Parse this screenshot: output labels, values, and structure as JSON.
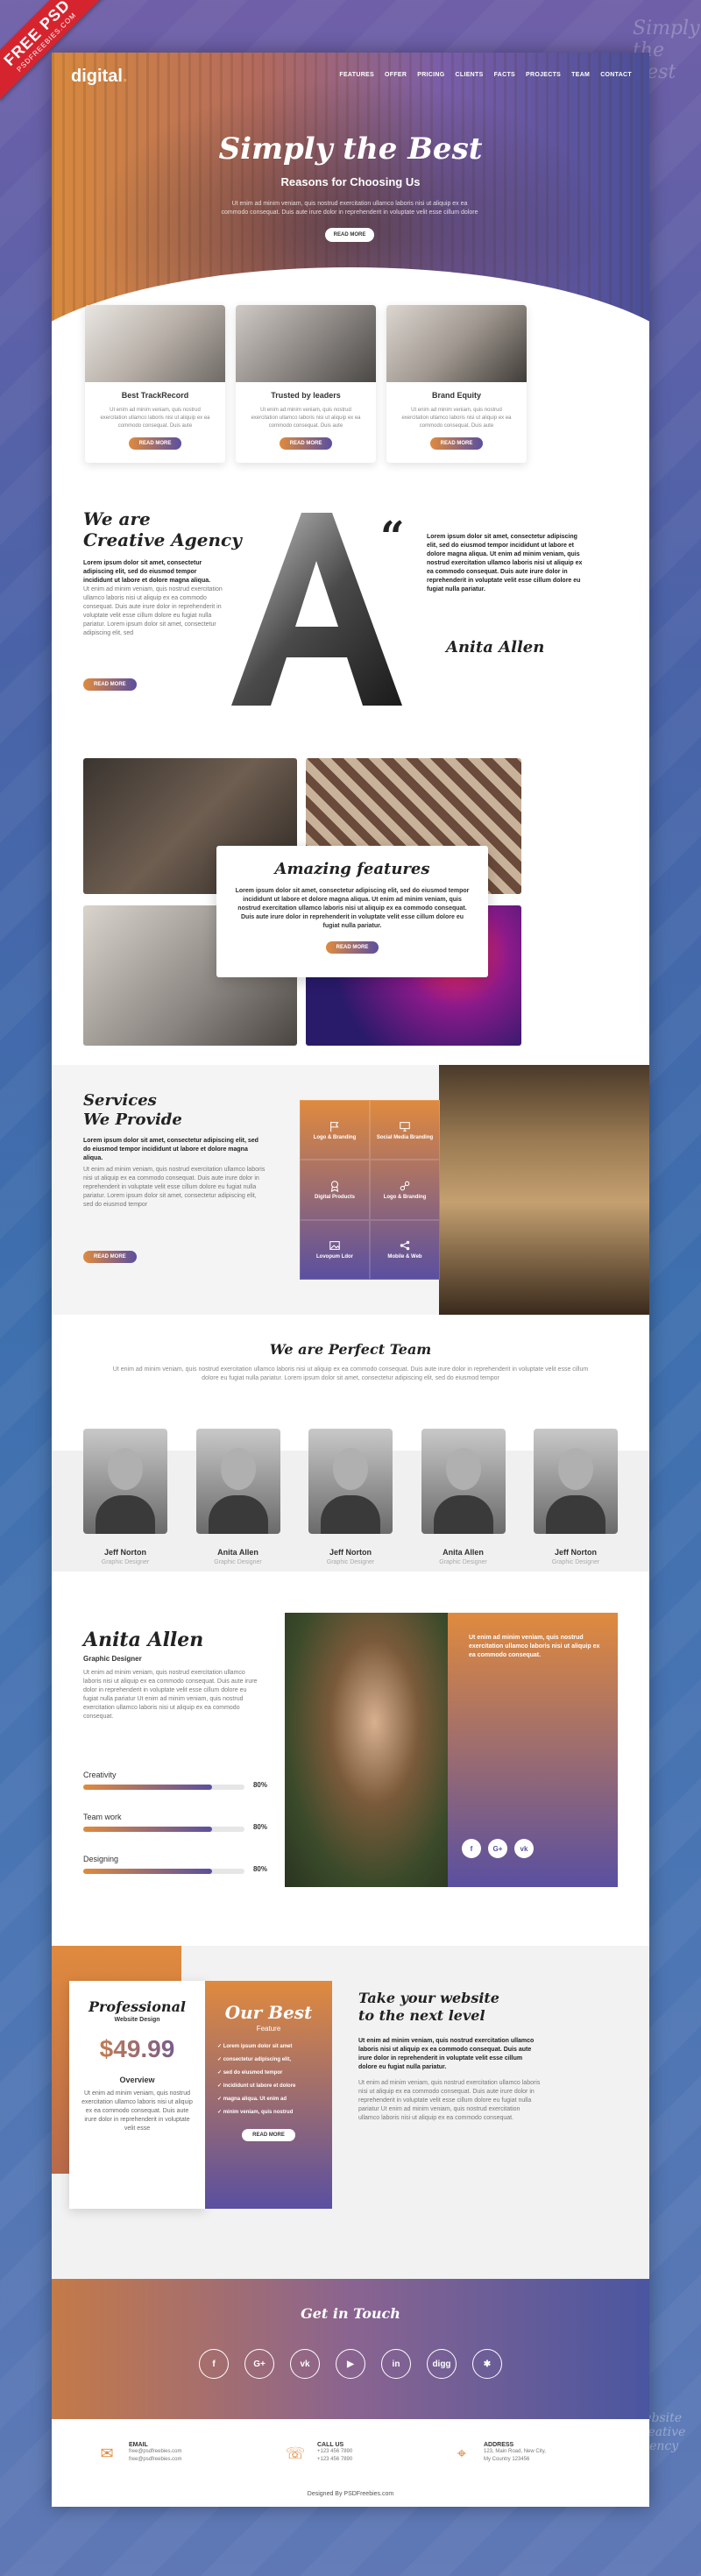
{
  "ribbon": {
    "title": "FREE PSD",
    "sub": "PSDFREEBIES.COM"
  },
  "side_text": "Simply the Best",
  "side_text_bottom": "Website Creative Agency",
  "nav": {
    "logo": "digital",
    "items": [
      "FEATURES",
      "OFFER",
      "PRICING",
      "CLIENTS",
      "FACTS",
      "PROJECTS",
      "TEAM",
      "CONTACT"
    ]
  },
  "hero": {
    "title": "Simply the Best",
    "subtitle": "Reasons for Choosing Us",
    "text": "Ut enim ad minim veniam, quis nostrud exercitation ullamco laboris nisi ut aliquip ex ea commodo consequat. Duis aute irure dolor in reprehenderit in voluptate velit esse cillum dolore",
    "button": "READ MORE"
  },
  "cards": [
    {
      "title": "Best TrackRecord",
      "text": "Ut enim ad minim veniam, quis nostrud exercitation ullamco laboris nisi ut aliquip ex ea commodo consequat. Duis aute",
      "button": "READ MORE"
    },
    {
      "title": "Trusted by leaders",
      "text": "Ut enim ad minim veniam, quis nostrud exercitation ullamco laboris nisi ut aliquip ex ea commodo consequat. Duis aute",
      "button": "READ MORE"
    },
    {
      "title": "Brand Equity",
      "text": "Ut enim ad minim veniam, quis nostrud exercitation ullamco laboris nisi ut aliquip ex ea commodo consequat. Duis aute",
      "button": "READ MORE"
    }
  ],
  "agency": {
    "title_1": "We are",
    "title_2": "Creative Agency",
    "lead": "Lorem ipsum dolor sit amet, consectetur adipiscing elit, sed do eiusmod tempor incididunt ut labore et dolore magna aliqua.",
    "body": "Ut enim ad minim veniam, quis nostrud exercitation ullamco laboris nisi ut aliquip ex ea commodo consequat. Duis aute irure dolor in reprehenderit in voluptate velit esse cillum dolore eu fugiat nulla pariatur. Lorem ipsum dolor sit amet, consectetur adipiscing elit, sed",
    "button": "READ MORE",
    "quote": "Lorem ipsum dolor sit amet, consectetur adipiscing elit, sed do eiusmod tempor incididunt ut labore et dolore magna aliqua. Ut enim ad minim veniam, quis nostrud exercitation ullamco laboris nisi ut aliquip ex ea commodo consequat. Duis aute irure dolor in reprehenderit in voluptate velit esse cillum dolore eu fugiat nulla pariatur.",
    "signature": "Anita Allen",
    "big_letter": "A"
  },
  "features": {
    "title": "Amazing features",
    "text": "Lorem ipsum dolor sit amet, consectetur adipiscing elit, sed do eiusmod tempor incididunt ut labore et dolore magna aliqua. Ut enim ad minim veniam, quis nostrud exercitation ullamco laboris nisi ut aliquip ex ea commodo consequat. Duis aute irure dolor in reprehenderit in voluptate velit esse cillum dolore eu fugiat nulla pariatur.",
    "button": "READ MORE"
  },
  "services": {
    "title_1": "Services",
    "title_2": "We Provide",
    "lead": "Lorem ipsum dolor sit amet, consectetur adipiscing elit, sed do eiusmod tempor incididunt ut labore et dolore magna aliqua.",
    "body": "Ut enim ad minim veniam, quis nostrud exercitation ullamco laboris nisi ut aliquip ex ea commodo consequat. Duis aute irure dolor in reprehenderit in voluptate velit esse cillum dolore eu fugiat nulla pariatur. Lorem ipsum dolor sit amet, consectetur adipiscing elit, sed do eiusmod tempor",
    "button": "READ MORE",
    "grid": [
      {
        "label": "Logo & Branding",
        "icon": "flag-icon"
      },
      {
        "label": "Social Media Branding",
        "icon": "monitor-icon"
      },
      {
        "label": "Digital Products",
        "icon": "ribbon-icon"
      },
      {
        "label": "Logo & Branding",
        "icon": "link-icon"
      },
      {
        "label": "Lovopum Ldor",
        "icon": "image-icon"
      },
      {
        "label": "Mobile & Web",
        "icon": "share-icon"
      }
    ]
  },
  "team": {
    "title": "We are Perfect Team",
    "text": "Ut enim ad minim veniam, quis nostrud exercitation ullamco laboris nisi ut aliquip ex ea commodo consequat. Duis aute irure dolor in reprehenderit in voluptate velit esse cillum dolore eu fugiat nulla pariatur. Lorem ipsum dolor sit amet, consectetur adipiscing elit, sed do eiusmod tempor",
    "members": [
      {
        "name": "Jeff Norton",
        "role": "Graphic Designer"
      },
      {
        "name": "Anita Allen",
        "role": "Graphic Designer"
      },
      {
        "name": "Jeff Norton",
        "role": "Graphic Designer"
      },
      {
        "name": "Anita Allen",
        "role": "Graphic Designer"
      },
      {
        "name": "Jeff Norton",
        "role": "Graphic Designer"
      }
    ]
  },
  "profile": {
    "name": "Anita Allen",
    "role": "Graphic Designer",
    "text": "Ut enim ad minim veniam, quis nostrud exercitation ullamco laboris nisi ut aliquip ex ea commodo consequat. Duis aute irure dolor in reprehenderit in voluptate velit esse cillum dolore eu fugiat nulla pariatur Ut enim ad minim veniam, quis nostrud exercitation ullamco laboris nisi ut aliquip ex ea commodo consequat.",
    "skills": [
      {
        "label": "Creativity",
        "value": 80,
        "display": "80%"
      },
      {
        "label": "Team work",
        "value": 80,
        "display": "80%"
      },
      {
        "label": "Designing",
        "value": 80,
        "display": "80%"
      }
    ],
    "quote": "Ut enim ad minim veniam, quis nostrud exercitation ullamco laboris nisi ut aliquip ex ea commodo consequat.",
    "socials": [
      "f",
      "G+",
      "vk"
    ]
  },
  "pricing": {
    "plan_title": "Professional",
    "plan_sub": "Website Design",
    "price": "$49.99",
    "overview": "Overview",
    "overview_text": "Ut enim ad minim veniam, quis nostrud exercitation ullamco laboris nisi ut aliquip ex ea commodo consequat. Duis aute irure dolor in reprehenderit in voluptate velit esse",
    "best_title": "Our Best",
    "best_sub": "Feature",
    "best_items": [
      "Lorem ipsum dolor sit amet",
      "consectetur adipiscing elit,",
      "sed do eiusmod tempor",
      "incididunt ut labore et dolore",
      "magna aliqua. Ut enim ad",
      "minim veniam, quis nostrud"
    ],
    "best_button": "READ MORE",
    "right_title_1": "Take your website",
    "right_title_2": "to the next level",
    "right_lead": "Ut enim ad minim veniam, quis nostrud exercitation ullamco laboris nisi ut aliquip ex ea commodo consequat. Duis aute irure dolor in reprehenderit in voluptate velit esse cillum dolore eu fugiat nulla pariatur.",
    "right_body": "Ut enim ad minim veniam, quis nostrud exercitation ullamco laboris nisi ut aliquip ex ea commodo consequat. Duis aute irure dolor in reprehenderit in voluptate velit esse cillum dolore eu fugiat nulla pariatur Ut enim ad minim veniam, quis nostrud exercitation ullamco laboris nisi ut aliquip ex ea commodo consequat."
  },
  "touch": {
    "title": "Get in Touch",
    "icons": [
      {
        "glyph": "f",
        "name": "facebook-icon"
      },
      {
        "glyph": "G+",
        "name": "google-plus-icon"
      },
      {
        "glyph": "vk",
        "name": "vk-icon"
      },
      {
        "glyph": "▶",
        "name": "youtube-icon"
      },
      {
        "glyph": "in",
        "name": "linkedin-icon"
      },
      {
        "glyph": "digg",
        "name": "digg-icon"
      },
      {
        "glyph": "✱",
        "name": "other-social-icon"
      }
    ]
  },
  "footer": {
    "email_label": "EMAIL",
    "email_1": "free@psdfreebies.com",
    "email_2": "free@psdfreebies.com",
    "call_label": "CALL US",
    "phone_1": "+123 456 7890",
    "phone_2": "+123 456 7890",
    "address_label": "ADDRESS",
    "address_1": "123, Main Road, New City,",
    "address_2": "My Country 123456",
    "copyright": "Designed By PSDFreebies.com"
  },
  "colors": {
    "accent_orange": "#e08a3e",
    "accent_purple": "#5a4fa0",
    "ribbon": "#d6242f"
  }
}
